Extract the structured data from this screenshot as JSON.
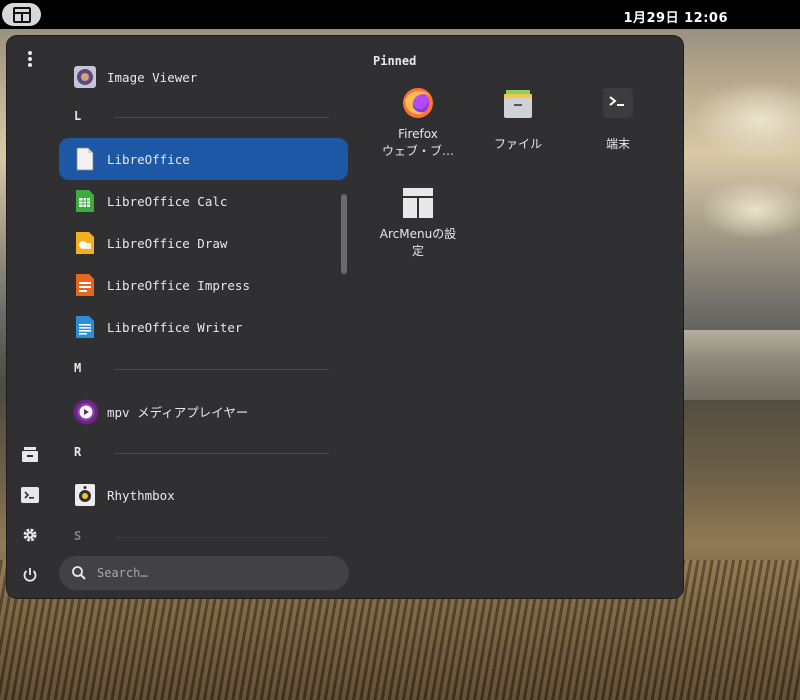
{
  "topbar": {
    "clock": "1月29日  12:06"
  },
  "menu": {
    "app_list": {
      "items_top": [
        {
          "label": "Image Viewer",
          "icon": "image-viewer-icon"
        }
      ],
      "sections": [
        {
          "letter": "L"
        },
        {
          "letter": "M"
        },
        {
          "letter": "R"
        },
        {
          "letter": "S"
        }
      ],
      "libreoffice": {
        "label": "LibreOffice"
      },
      "calc": {
        "label": "LibreOffice Calc"
      },
      "draw": {
        "label": "LibreOffice Draw"
      },
      "impress": {
        "label": "LibreOffice Impress"
      },
      "writer": {
        "label": "LibreOffice Writer"
      },
      "mpv": {
        "label": "mpv メディアプレイヤー"
      },
      "rhythmbox": {
        "label": "Rhythmbox"
      }
    },
    "search": {
      "placeholder": "Search…"
    },
    "pinned": {
      "title": "Pinned",
      "items": [
        {
          "label_line1": "Firefox",
          "label_line2": "ウェブ・ブ…"
        },
        {
          "label_line1": "ファイル"
        },
        {
          "label_line1": "端末"
        },
        {
          "label_line1": "ArcMenuの設",
          "label_line2": "定"
        }
      ]
    },
    "accent_color": "#1d58a6"
  }
}
